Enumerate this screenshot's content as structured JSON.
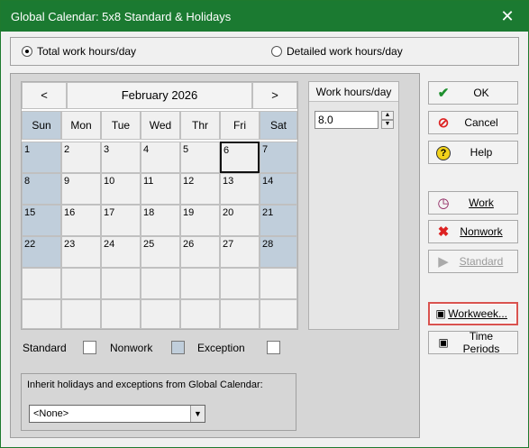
{
  "window": {
    "title": "Global Calendar: 5x8 Standard & Holidays",
    "close_glyph": "✕"
  },
  "mode": {
    "total_label": "Total work hours/day",
    "detailed_label": "Detailed work hours/day",
    "selected": "total"
  },
  "calendar": {
    "prev": "<",
    "next": ">",
    "month_label": "February 2026",
    "weekdays": [
      "Sun",
      "Mon",
      "Tue",
      "Wed",
      "Thr",
      "Fri",
      "Sat"
    ],
    "weeks": [
      [
        "1",
        "2",
        "3",
        "4",
        "5",
        "6",
        "7"
      ],
      [
        "8",
        "9",
        "10",
        "11",
        "12",
        "13",
        "14"
      ],
      [
        "15",
        "16",
        "17",
        "18",
        "19",
        "20",
        "21"
      ],
      [
        "22",
        "23",
        "24",
        "25",
        "26",
        "27",
        "28"
      ],
      [
        "",
        "",
        "",
        "",
        "",
        "",
        ""
      ]
    ],
    "selected_day": "6"
  },
  "work_hours": {
    "header": "Work hours/day",
    "value": "8.0"
  },
  "legend": {
    "standard": "Standard",
    "nonwork": "Nonwork",
    "exception": "Exception"
  },
  "inherit": {
    "label": "Inherit holidays and exceptions from Global Calendar:",
    "selected": "<None>"
  },
  "buttons": {
    "ok": "OK",
    "cancel": "Cancel",
    "help": "Help",
    "work": "Work",
    "nonwork": "Nonwork",
    "standard": "Standard",
    "workweek": "Workweek...",
    "time_periods": "Time Periods"
  },
  "colors": {
    "titlebar": "#1b7a31",
    "weekend": "#c0cedb",
    "highlight": "#d9534f"
  }
}
